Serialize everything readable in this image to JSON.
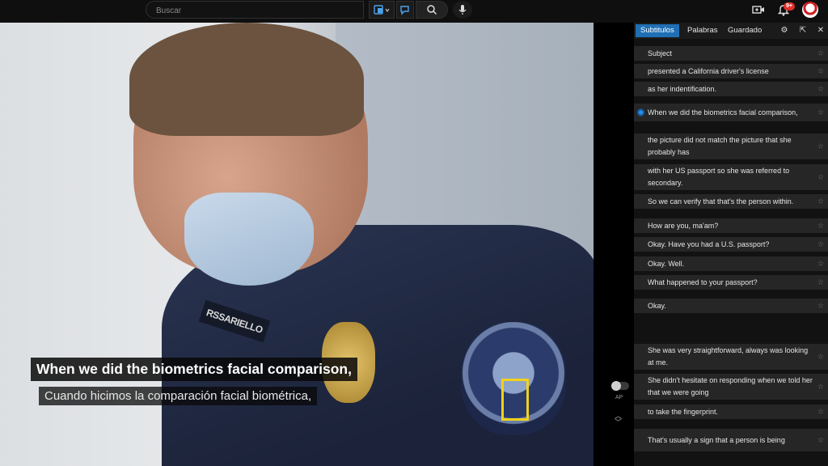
{
  "topbar": {
    "search_placeholder": "Buscar",
    "notifications_badge": "9+",
    "icons": [
      "language-select-icon",
      "chat-translate-icon",
      "search-icon",
      "mic-icon",
      "create-video-icon",
      "bell-icon"
    ]
  },
  "video": {
    "nametag": "RSSARIELLO",
    "subtitle_primary": "When we did the biometrics facial comparison,",
    "subtitle_secondary": "Cuando hicimos la comparación facial biométrica,",
    "highlight_color": "#f2d21a"
  },
  "controls": {
    "autopause_label": "AP"
  },
  "panel": {
    "tabs": [
      "Subtitulos",
      "Palabras",
      "Guardado"
    ],
    "active_tab": "Subtitulos",
    "accent": "#1f6fb5",
    "rows": [
      {
        "text": "Subject"
      },
      {
        "text": "presented a California driver's license"
      },
      {
        "text": "as her indentification."
      },
      {
        "text": "When we did the biometrics facial comparison,",
        "current": true
      },
      {
        "text": "the picture did not match the picture that she probably has"
      },
      {
        "text": "with her US passport so she was referred to secondary."
      },
      {
        "text": "So we can verify that that's the person within."
      },
      {
        "text": "How are you, ma'am?"
      },
      {
        "text": "Okay. Have you had a U.S. passport?"
      },
      {
        "text": "Okay. Well."
      },
      {
        "text": "What happened to your passport?"
      },
      {
        "text": "Okay."
      },
      {
        "text": "She was very straightforward, always was looking at me."
      },
      {
        "text": "She didn't hesitate on responding when we told her that we were going"
      },
      {
        "text": "to take the fingerprint."
      },
      {
        "text": "That's usually a sign that a person is being"
      }
    ]
  }
}
